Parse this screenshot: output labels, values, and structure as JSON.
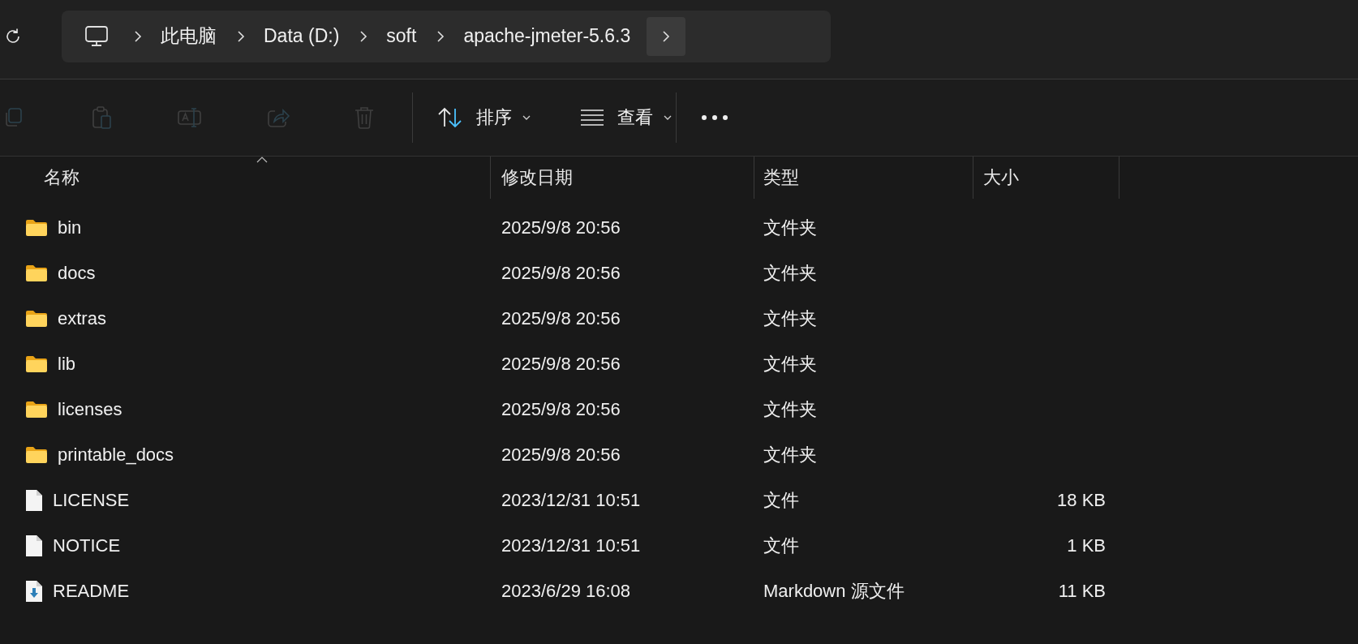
{
  "address_bar": {
    "segments": [
      "此电脑",
      "Data (D:)",
      "soft",
      "apache-jmeter-5.6.3"
    ]
  },
  "toolbar": {
    "actions": [
      {
        "kind": "copy",
        "disabled": true
      },
      {
        "kind": "paste",
        "disabled": true
      },
      {
        "kind": "rename",
        "disabled": true
      },
      {
        "kind": "share",
        "disabled": true
      },
      {
        "kind": "delete",
        "disabled": true
      },
      {
        "kind": "sort",
        "label": "排序",
        "disabled": false
      },
      {
        "kind": "view",
        "label": "查看",
        "disabled": false
      },
      {
        "kind": "more",
        "disabled": false
      }
    ]
  },
  "table": {
    "columns": [
      "名称",
      "修改日期",
      "类型",
      "大小"
    ],
    "rows": [
      {
        "kind": "folder",
        "name": "bin",
        "modified": "2025/9/8 20:56",
        "type": "文件夹"
      },
      {
        "kind": "folder",
        "name": "docs",
        "modified": "2025/9/8 20:56",
        "type": "文件夹"
      },
      {
        "kind": "folder",
        "name": "extras",
        "modified": "2025/9/8 20:56",
        "type": "文件夹"
      },
      {
        "kind": "folder",
        "name": "lib",
        "modified": "2025/9/8 20:56",
        "type": "文件夹"
      },
      {
        "kind": "folder",
        "name": "licenses",
        "modified": "2025/9/8 20:56",
        "type": "文件夹"
      },
      {
        "kind": "folder",
        "name": "printable_docs",
        "modified": "2025/9/8 20:56",
        "type": "文件夹"
      },
      {
        "kind": "file",
        "name": "LICENSE",
        "modified": "2023/12/31 10:51",
        "type": "文件",
        "size": "18 KB"
      },
      {
        "kind": "file",
        "name": "NOTICE",
        "modified": "2023/12/31 10:51",
        "type": "文件",
        "size": "1 KB"
      },
      {
        "kind": "markdown",
        "name": "README",
        "modified": "2023/6/29 16:08",
        "type": "Markdown 源文件",
        "size": "11 KB"
      }
    ]
  }
}
